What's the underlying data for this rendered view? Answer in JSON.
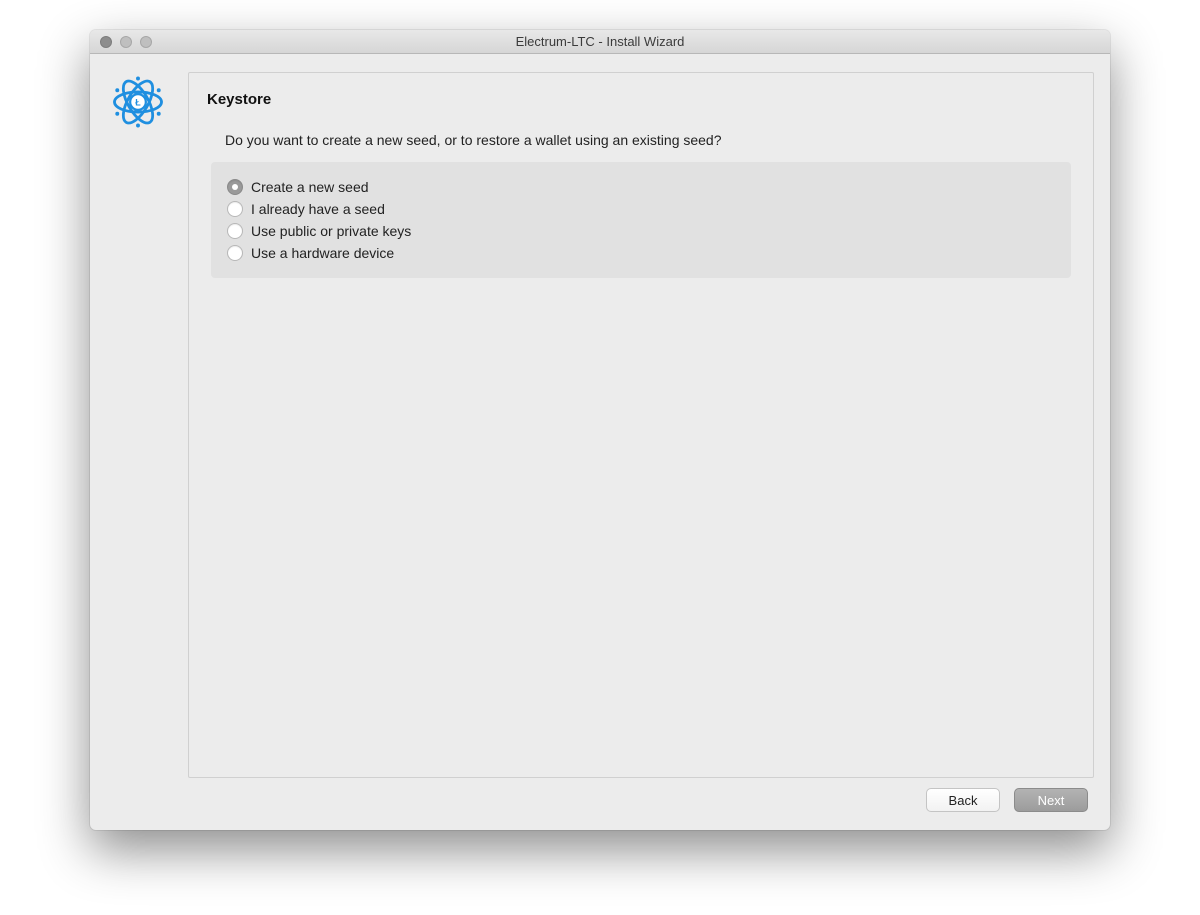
{
  "window": {
    "title": "Electrum-LTC  -  Install Wizard"
  },
  "wizard": {
    "heading": "Keystore",
    "prompt": "Do you want to create a new seed, or to restore a wallet using an existing seed?",
    "options": [
      {
        "label": "Create a new seed",
        "selected": true
      },
      {
        "label": "I already have a seed",
        "selected": false
      },
      {
        "label": "Use public or private keys",
        "selected": false
      },
      {
        "label": "Use a hardware device",
        "selected": false
      }
    ]
  },
  "buttons": {
    "back": "Back",
    "next": "Next"
  },
  "icon_name": "electrum-ltc-logo"
}
